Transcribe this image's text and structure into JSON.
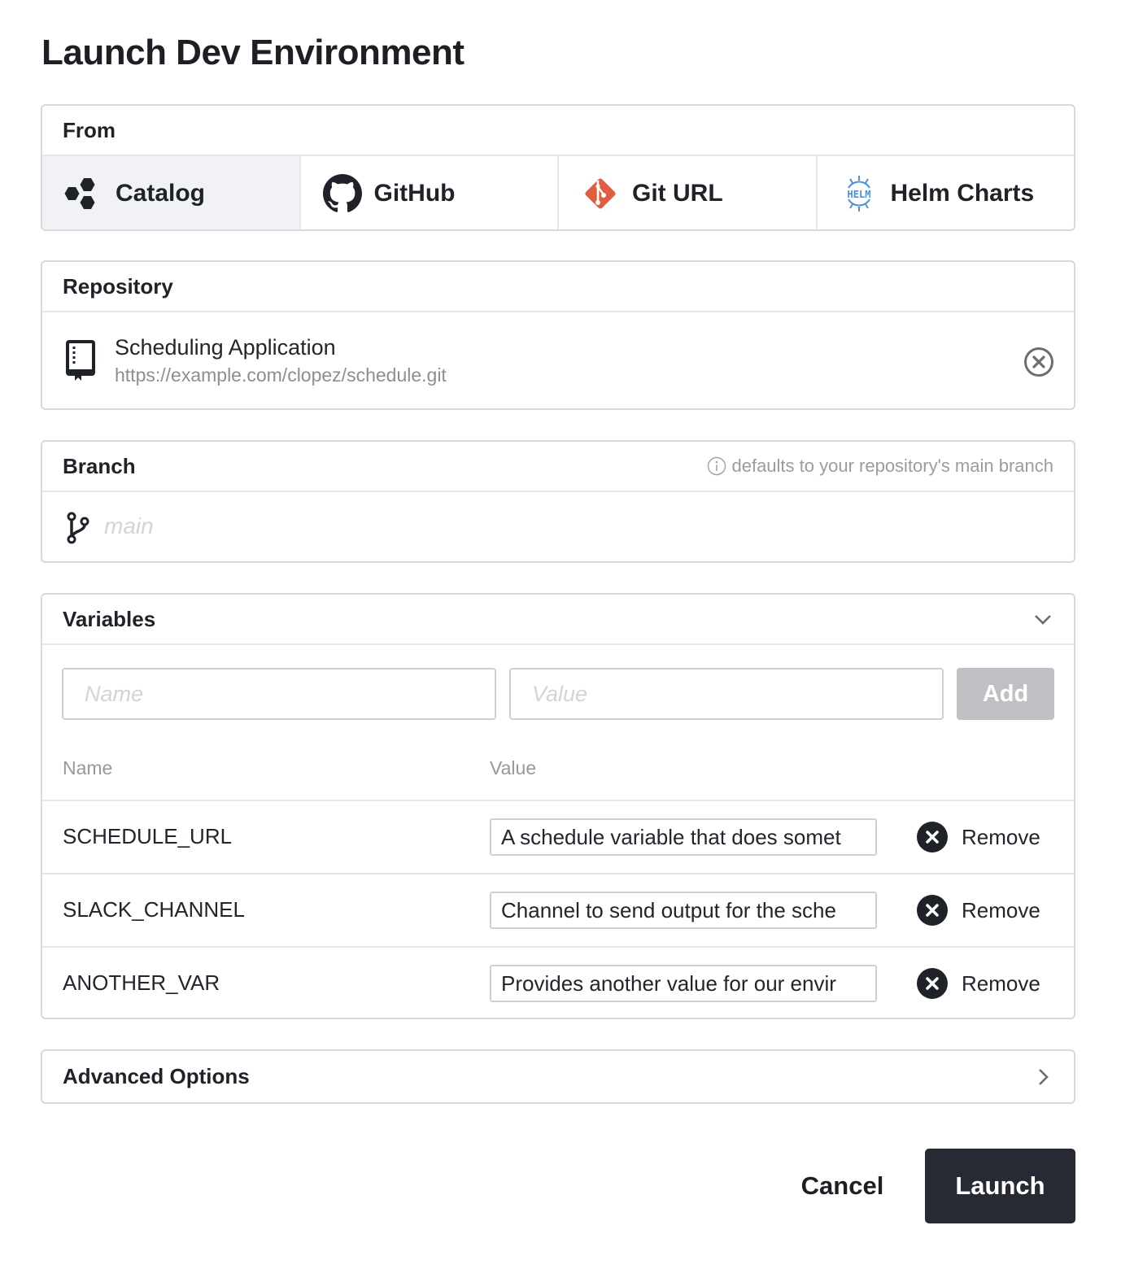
{
  "page": {
    "title": "Launch Dev Environment"
  },
  "from": {
    "label": "From",
    "selected": "Catalog",
    "tabs": [
      {
        "label": "Catalog",
        "icon": "catalog-hexagons-icon"
      },
      {
        "label": "GitHub",
        "icon": "github-icon"
      },
      {
        "label": "Git URL",
        "icon": "git-icon"
      },
      {
        "label": "Helm Charts",
        "icon": "helm-icon"
      }
    ],
    "helm_icon_text": "HELM"
  },
  "repository": {
    "label": "Repository",
    "name": "Scheduling Application",
    "url": "https://example.com/clopez/schedule.git"
  },
  "branch": {
    "label": "Branch",
    "hint": "defaults to your repository's main branch",
    "value": "",
    "placeholder": "main"
  },
  "variables": {
    "label": "Variables",
    "name_placeholder": "Name",
    "value_placeholder": "Value",
    "add_label": "Add",
    "columns": {
      "name": "Name",
      "value": "Value"
    },
    "remove_label": "Remove",
    "rows": [
      {
        "name": "SCHEDULE_URL",
        "value": "A schedule variable that does somet"
      },
      {
        "name": "SLACK_CHANNEL",
        "value": "Channel to send output for the sche"
      },
      {
        "name": "ANOTHER_VAR",
        "value": "Provides another value for our envir"
      }
    ]
  },
  "advanced": {
    "label": "Advanced Options"
  },
  "footer": {
    "cancel_label": "Cancel",
    "launch_label": "Launch"
  },
  "colors": {
    "primary_button": "#272a33",
    "disabled_button": "#bfc0c3",
    "git_orange": "#e05d44",
    "helm_blue": "#4a90d9",
    "active_tab_bg": "#f1f2f5"
  }
}
